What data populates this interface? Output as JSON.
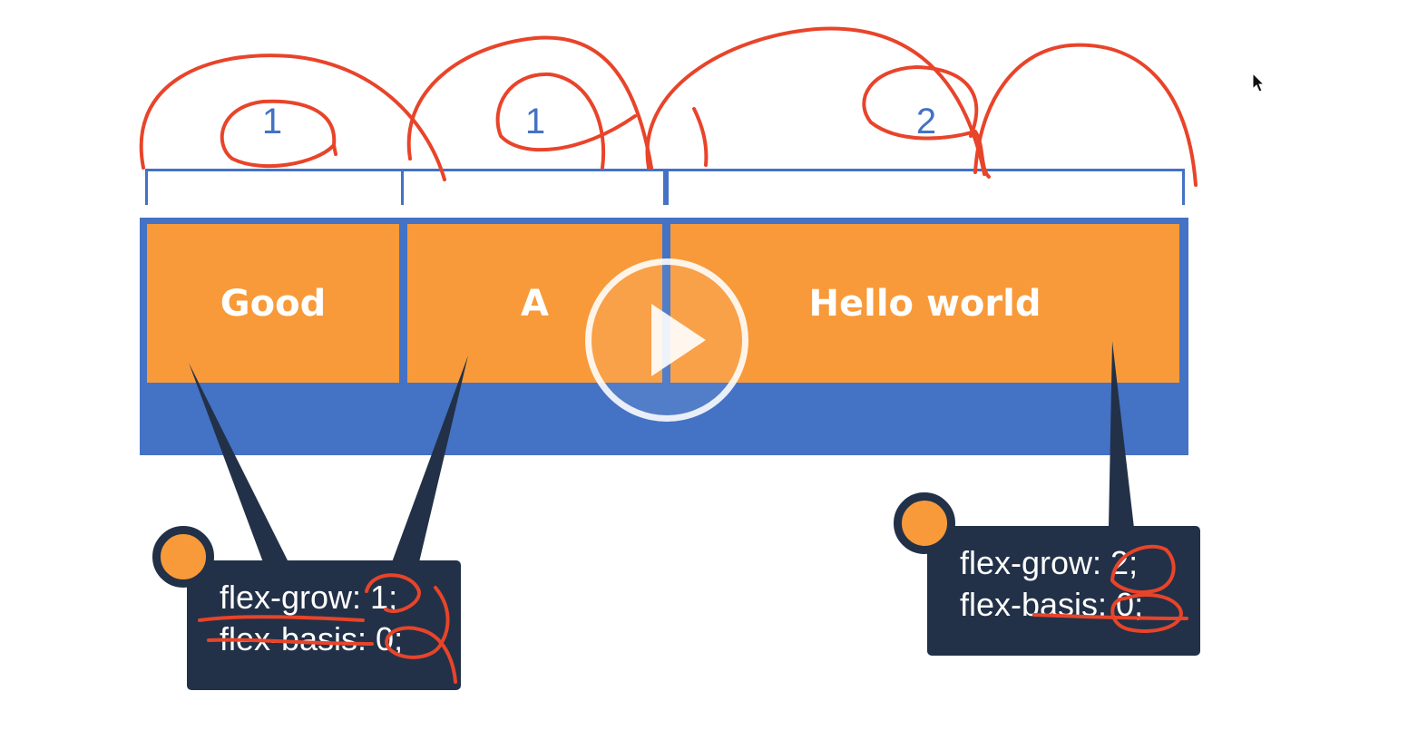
{
  "ratios": [
    "1",
    "1",
    "2"
  ],
  "items": [
    "Good",
    "A",
    "Hello world"
  ],
  "callout_left": {
    "grow_line": "flex-grow: 1;",
    "basis_line": "flex-basis: 0;"
  },
  "callout_right": {
    "grow_line": "flex-grow: 2;",
    "basis_line": "flex-basis: 0;"
  },
  "colors": {
    "container": "#4472c4",
    "item": "#f89a3a",
    "callout": "#223147",
    "annotation": "#e8442a"
  },
  "icons": [
    "play-icon",
    "cursor-icon"
  ]
}
